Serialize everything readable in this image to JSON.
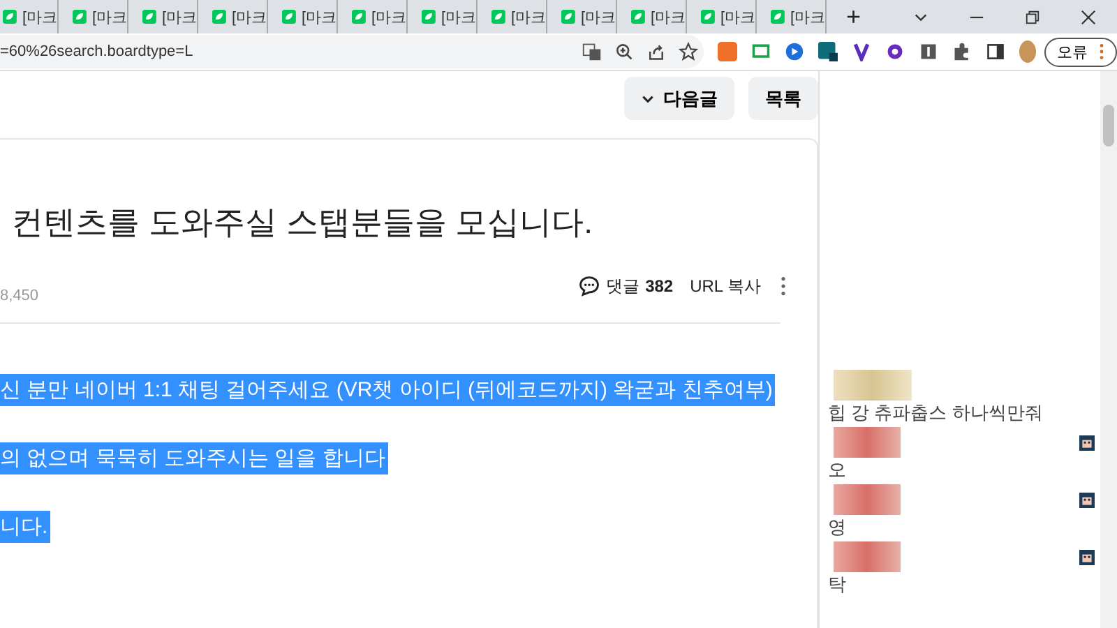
{
  "browser": {
    "tabs": [
      {
        "label": "[마크",
        "selected": false
      },
      {
        "label": "[마크",
        "selected": false
      },
      {
        "label": "[마크",
        "selected": false
      },
      {
        "label": "[마크",
        "selected": false
      },
      {
        "label": "[마크",
        "selected": false
      },
      {
        "label": "[마크",
        "selected": false
      },
      {
        "label": "[마크",
        "selected": false
      },
      {
        "label": "[마크",
        "selected": false
      },
      {
        "label": "[마크",
        "selected": false
      },
      {
        "label": "[마크",
        "selected": false
      },
      {
        "label": "[마크",
        "selected": false
      },
      {
        "label": "[마크",
        "selected": false
      }
    ],
    "new_tab": "+",
    "address": "=60%26search.boardtype=L",
    "profile_button": "오류"
  },
  "nav_buttons": {
    "next": "다음글",
    "list": "목록"
  },
  "post": {
    "title": "컨텐츠를 도와주실 스탭분들을 모십니다.",
    "views": "8,450",
    "comments_label": "댓글",
    "comments_count": "382",
    "url_copy": "URL 복사",
    "selected_lines": [
      "신 분만 네이버 1:1 채팅 걸어주세요 (VR챗 아이디 (뒤에코드까지) 왁굳과 친추여부)",
      "의 없으며 묵묵히 도와주시는 일을 합니다",
      "니다."
    ]
  },
  "chat": [
    {
      "text": "힙 강 츄파춥스 하나씩만줘",
      "badge": false
    },
    {
      "text": "오",
      "badge": true
    },
    {
      "text": "영",
      "badge": true
    },
    {
      "text": "탁",
      "badge": true
    }
  ]
}
